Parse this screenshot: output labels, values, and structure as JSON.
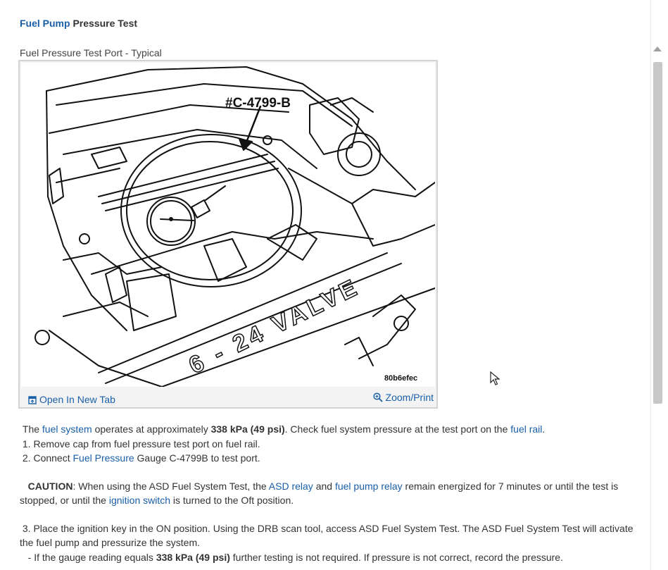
{
  "header": {
    "title_link": "Fuel Pump",
    "title_rest": " Pressure Test"
  },
  "figure": {
    "caption": "Fuel Pressure Test Port - Typical",
    "callout": "#C-4799-B",
    "engine_label": "6 - 24 VALVE",
    "ref_code": "80b6efec",
    "open_label": "Open In New Tab",
    "zoom_label": "Zoom/Print"
  },
  "content": {
    "intro_pre": "The ",
    "intro_link1": "fuel system",
    "intro_mid": " operates at approximately ",
    "intro_bold": "338 kPa (49 psi)",
    "intro_mid2": ". Check fuel system pressure at the test port on the ",
    "intro_link2": "fuel rail",
    "intro_end": ".",
    "step1": "1. Remove cap from fuel pressure test port on fuel rail.",
    "step2_pre": "2. Connect ",
    "step2_link": "Fuel Pressure",
    "step2_post": " Gauge C-4799B to test port.",
    "caution_label": "CAUTION",
    "caution_pre": ": When using the ASD Fuel System Test, the ",
    "caution_link1": "ASD relay",
    "caution_and": " and ",
    "caution_link2": "fuel pump relay",
    "caution_mid": " remain energized for 7 minutes or until the test is stopped, or until the ",
    "caution_link3": "ignition switch",
    "caution_end": " is turned to the Oft position.",
    "step3": "3. Place the ignition key in the ON position. Using the DRB scan tool, access ASD Fuel System Test. The ASD Fuel System Test will activate the fuel pump and pressurize the system.",
    "bullet_pre": "-  If the gauge reading equals ",
    "bullet_bold": "338 kPa (49 psi)",
    "bullet_post": " further testing is not required. If pressure is not correct, record the pressure."
  }
}
